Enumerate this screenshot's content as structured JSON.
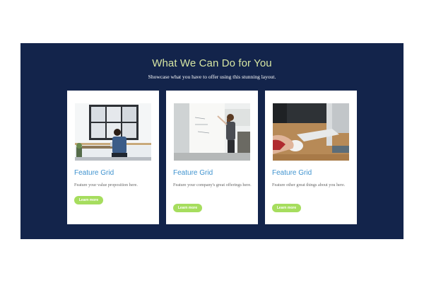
{
  "section": {
    "title": "What We Can Do for You",
    "subtitle": "Showcase what you have to offer using this stunning layout."
  },
  "colors": {
    "background": "#13244b",
    "title": "#d7e6a3",
    "card_title": "#3f93cf",
    "button": "#a6dd5e"
  },
  "cards": [
    {
      "title": "Feature Grid",
      "text": "Feature your value proposition here.",
      "button_label": "Learn more",
      "image": "office-man-at-desk-photo"
    },
    {
      "title": "Feature Grid",
      "text": "Feature your company's great offerings here.",
      "button_label": "Learn more",
      "image": "woman-at-whiteboard-photo"
    },
    {
      "title": "Feature Grid",
      "text": "Feature other great things about you here.",
      "button_label": "Learn more",
      "image": "hand-on-mouse-photo"
    }
  ]
}
